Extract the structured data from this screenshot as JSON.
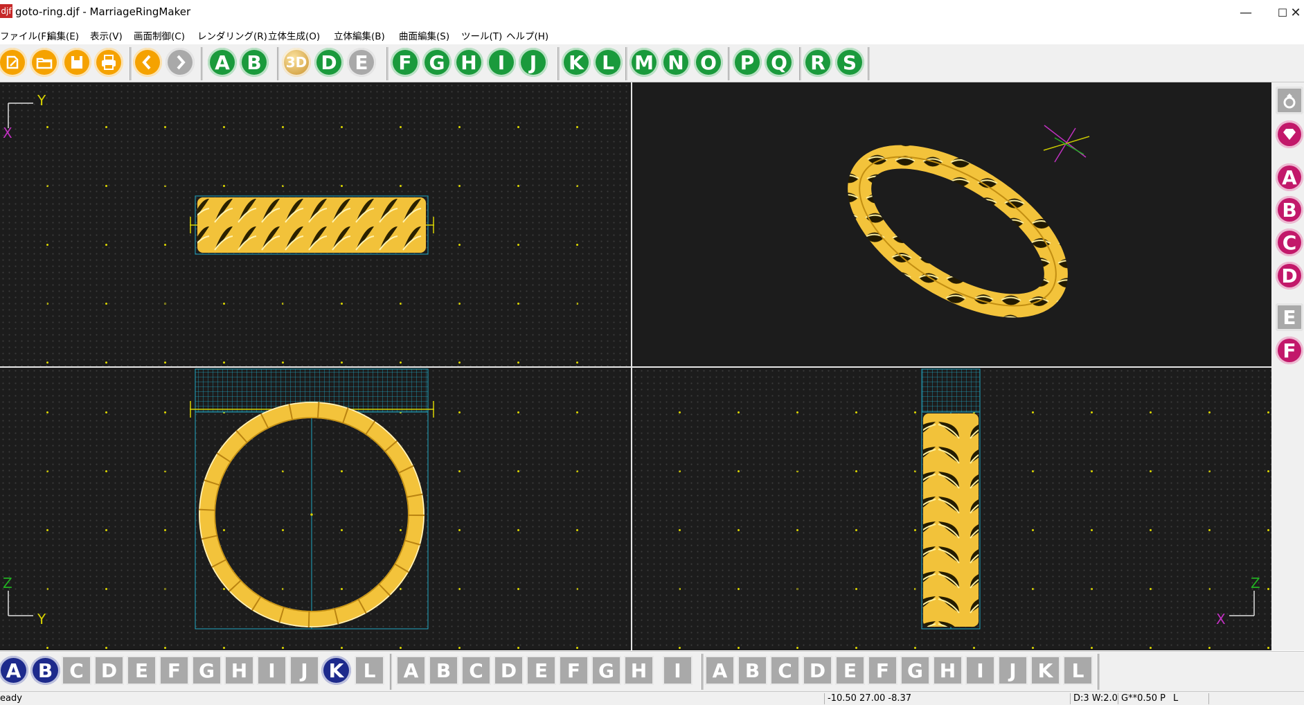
{
  "window": {
    "title": "goto-ring.djf - MarriageRingMaker",
    "app_icon_text": "djf",
    "minimize": "—",
    "maximize": "☐",
    "close": "✕"
  },
  "menu": [
    "ファイル(F)",
    "編集(E)",
    "表示(V)",
    "画面制御(C)",
    "レンダリング(R)",
    "立体生成(O)",
    "立体編集(B)",
    "曲面編集(S)",
    "ツール(T)",
    "ヘルプ(H)"
  ],
  "toolbar": {
    "file_icons": [
      "new-icon",
      "open-icon",
      "save-icon",
      "print-icon"
    ],
    "nav_icons": [
      "back-arrow-icon",
      "forward-arrow-icon"
    ],
    "group1": [
      "A",
      "B"
    ],
    "render3d": "3D",
    "group2": [
      "D",
      "E"
    ],
    "group3": [
      "F",
      "G",
      "H",
      "I",
      "J"
    ],
    "group4": [
      "K",
      "L"
    ],
    "group5": [
      "M",
      "N",
      "O"
    ],
    "group6": [
      "P",
      "Q"
    ],
    "group7": [
      "R",
      "S"
    ]
  },
  "viewports": {
    "top_left": {
      "axis_up": "Y",
      "axis_right": "X"
    },
    "bottom_left": {
      "axis_up": "Z",
      "axis_right": "Y"
    },
    "bottom_right": {
      "axis_up": "Z",
      "axis_right": "X"
    }
  },
  "sidebar": {
    "icons": [
      "ring-icon",
      "gem-icon"
    ],
    "magenta": [
      "A",
      "B",
      "C",
      "D"
    ],
    "gray": [
      "E",
      "F"
    ]
  },
  "bottom_toolbar": {
    "group1": [
      "A",
      "B",
      "C",
      "D",
      "E",
      "F",
      "G",
      "H",
      "I",
      "J",
      "K",
      "L"
    ],
    "group2": [
      "A",
      "B",
      "C",
      "D",
      "E",
      "F",
      "G",
      "H"
    ],
    "group3": [
      "I"
    ],
    "group4": [
      "A",
      "B",
      "C",
      "D",
      "E",
      "F",
      "G",
      "H",
      "I",
      "J",
      "K",
      "L"
    ]
  },
  "status": {
    "ready": "eady",
    "coords": "-10.50 27.00 -8.37",
    "grid": "D:3 W:2.0",
    "params": "G**0.50 P",
    "mode": "L"
  },
  "colors": {
    "gold": "#f5c542",
    "viewport_bg": "#1c1c1c",
    "grid_dot": "#d8d300",
    "cyan": "#1fa8c4",
    "green_btn": "#1a9a3c",
    "magenta_btn": "#c2186a",
    "navy_btn": "#1d2a8c"
  }
}
